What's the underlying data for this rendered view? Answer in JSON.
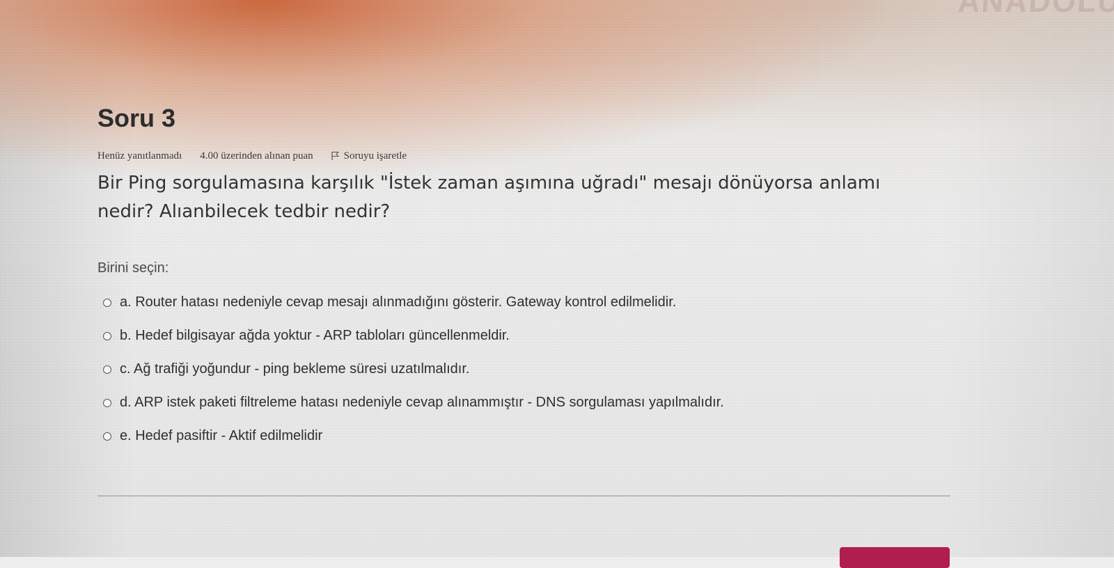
{
  "banner": {
    "text": "ANADOLU"
  },
  "question": {
    "title": "Soru 3",
    "status": "Henüz yanıtlanmadı",
    "points": "4.00 üzerinden alınan puan",
    "flag_label": "Soruyu işaretle",
    "text": "Bir Ping sorgulamasına karşılık \"İstek zaman aşımına uğradı\" mesajı dönüyorsa anlamı nedir? Alıanbilecek tedbir nedir?",
    "prompt": "Birini seçin:",
    "answers": [
      "a. Router hatası nedeniyle cevap mesajı alınmadığını gösterir. Gateway kontrol edilmelidir.",
      "b. Hedef bilgisayar ağda yoktur - ARP tabloları güncellenmeldir.",
      "c. Ağ trafiği yoğundur - ping bekleme süresi uzatılmalıdır.",
      "d. ARP istek paketi filtreleme hatası nedeniyle cevap alınammıştır - DNS sorgulaması yapılmalıdır.",
      "e. Hedef pasiftir - Aktif edilmelidir"
    ]
  },
  "colors": {
    "accent": "#b01d4f",
    "top_glow": "#cb6236"
  }
}
